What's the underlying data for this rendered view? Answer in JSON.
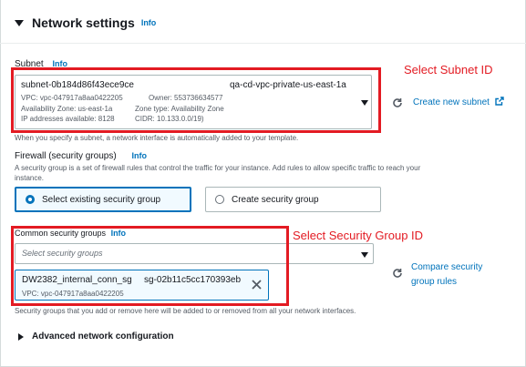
{
  "header": {
    "title": "Network settings",
    "info": "Info"
  },
  "subnet": {
    "label": "Subnet",
    "info": "Info",
    "id": "subnet-0b184d86f43ece9ce",
    "name": "qa-cd-vpc-private-us-east-1a",
    "vpc": "VPC: vpc-047917a8aa0422205",
    "owner": "Owner: 553736634577",
    "az": "Availability Zone: us-east-1a",
    "zone_type": "Zone type: Availability Zone",
    "ips": "IP addresses available: 8128",
    "cidr": "CIDR: 10.133.0.0/19)",
    "create_link": "Create new subnet",
    "hint": "When you specify a subnet, a network interface is automatically added to your template."
  },
  "annotations": {
    "subnet": "Select Subnet ID",
    "security_group": "Select Security Group ID"
  },
  "firewall": {
    "label": "Firewall (security groups)",
    "info": "Info",
    "description_line1": "A security group is a set of firewall rules that control the traffic for your instance. Add rules to allow specific traffic to reach your",
    "description_line2": "instance.",
    "options": [
      {
        "label": "Select existing security group",
        "selected": true
      },
      {
        "label": "Create security group",
        "selected": false
      }
    ]
  },
  "common_sg": {
    "label": "Common security groups",
    "info": "Info",
    "placeholder": "Select security groups",
    "compare_link_line1": "Compare security",
    "compare_link_line2": "group rules",
    "selected": {
      "name": "DW2382_internal_conn_sg",
      "id": "sg-02b11c5cc170393eb",
      "vpc": "VPC: vpc-047917a8aa0422205"
    },
    "hint": "Security groups that you add or remove here will be added to or removed from all your network interfaces."
  },
  "advanced": {
    "label": "Advanced network configuration"
  },
  "colors": {
    "accent": "#0073bb",
    "annotation": "#e31b23"
  }
}
